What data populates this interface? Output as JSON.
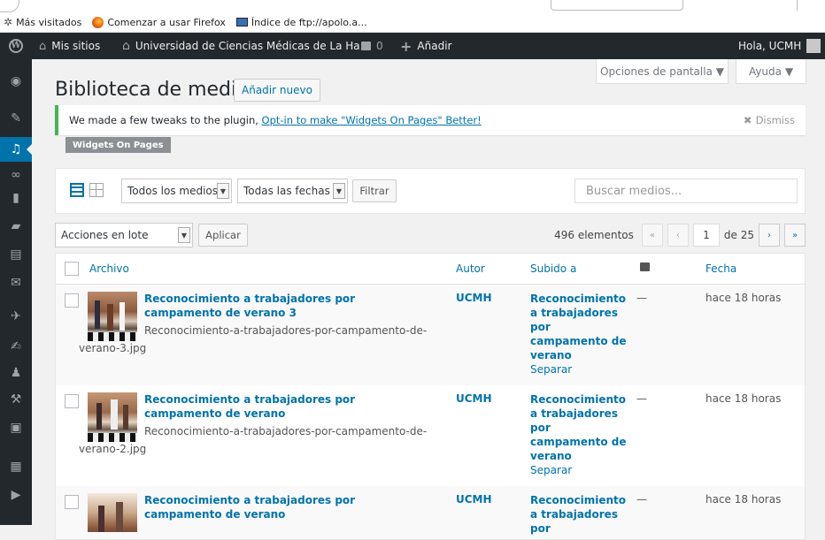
{
  "browser": {
    "bookmarks": [
      {
        "icon": "gear-icon",
        "label": "Más visitados"
      },
      {
        "icon": "firefox-icon",
        "label": "Comenzar a usar Firefox"
      },
      {
        "icon": "monitor-icon",
        "label": "Índice de ftp://apolo.a..."
      }
    ]
  },
  "adminbar": {
    "wp_logo": "wordpress-icon",
    "my_sites": "Mis sitios",
    "site_name": "Universidad de Ciencias Médicas de La Ha...",
    "comments_count": "0",
    "add_new": "Añadir",
    "greeting": "Hola, UCMH"
  },
  "screen_tabs": {
    "options": "Opciones de pantalla ▼",
    "help": "Ayuda ▼"
  },
  "page": {
    "title": "Biblioteca de medios",
    "add_new": "Añadir nuevo"
  },
  "notice": {
    "text": "We made a few tweaks to the plugin, ",
    "link": "Opt-in to make \"Widgets On Pages\" Better!",
    "dismiss": "Dismiss",
    "badge": "Widgets On Pages"
  },
  "filters": {
    "media_type": "Todos los medios",
    "dates": "Todas las fechas",
    "filter_button": "Filtrar",
    "search_placeholder": "Buscar medios..."
  },
  "bulk": {
    "actions": "Acciones en lote",
    "apply": "Aplicar",
    "items_count": "496 elementos",
    "first": "«",
    "prev": "‹",
    "current_page": "1",
    "of_pages": "de 25",
    "next": "›",
    "last": "»"
  },
  "table": {
    "headers": {
      "file": "Archivo",
      "author": "Autor",
      "uploaded_to": "Subido a",
      "date": "Fecha"
    },
    "rows": [
      {
        "title": "Reconocimiento a trabajadores por campamento de verano 3",
        "filename": "Reconocimiento-a-trabajadores-por-campamento-de-verano-3.jpg",
        "author": "UCMH",
        "uploaded_to": "Reconocimiento a trabajadores por campamento de verano",
        "detach": "Separar",
        "comments": "—",
        "date": "hace 18 horas"
      },
      {
        "title": "Reconocimiento a trabajadores por campamento de verano",
        "filename": "Reconocimiento-a-trabajadores-por-campamento-de-verano-2.jpg",
        "author": "UCMH",
        "uploaded_to": "Reconocimiento a trabajadores por campamento de verano",
        "detach": "Separar",
        "comments": "—",
        "date": "hace 18 horas"
      },
      {
        "title": "Reconocimiento a trabajadores por campamento de verano",
        "filename": "",
        "author": "UCMH",
        "uploaded_to": "Reconocimiento a trabajadores por",
        "detach": "",
        "comments": "—",
        "date": "hace 18 horas"
      }
    ]
  },
  "colors": {
    "accent": "#0073aa",
    "adminbar": "#23282d",
    "notice_border": "#46b450"
  }
}
